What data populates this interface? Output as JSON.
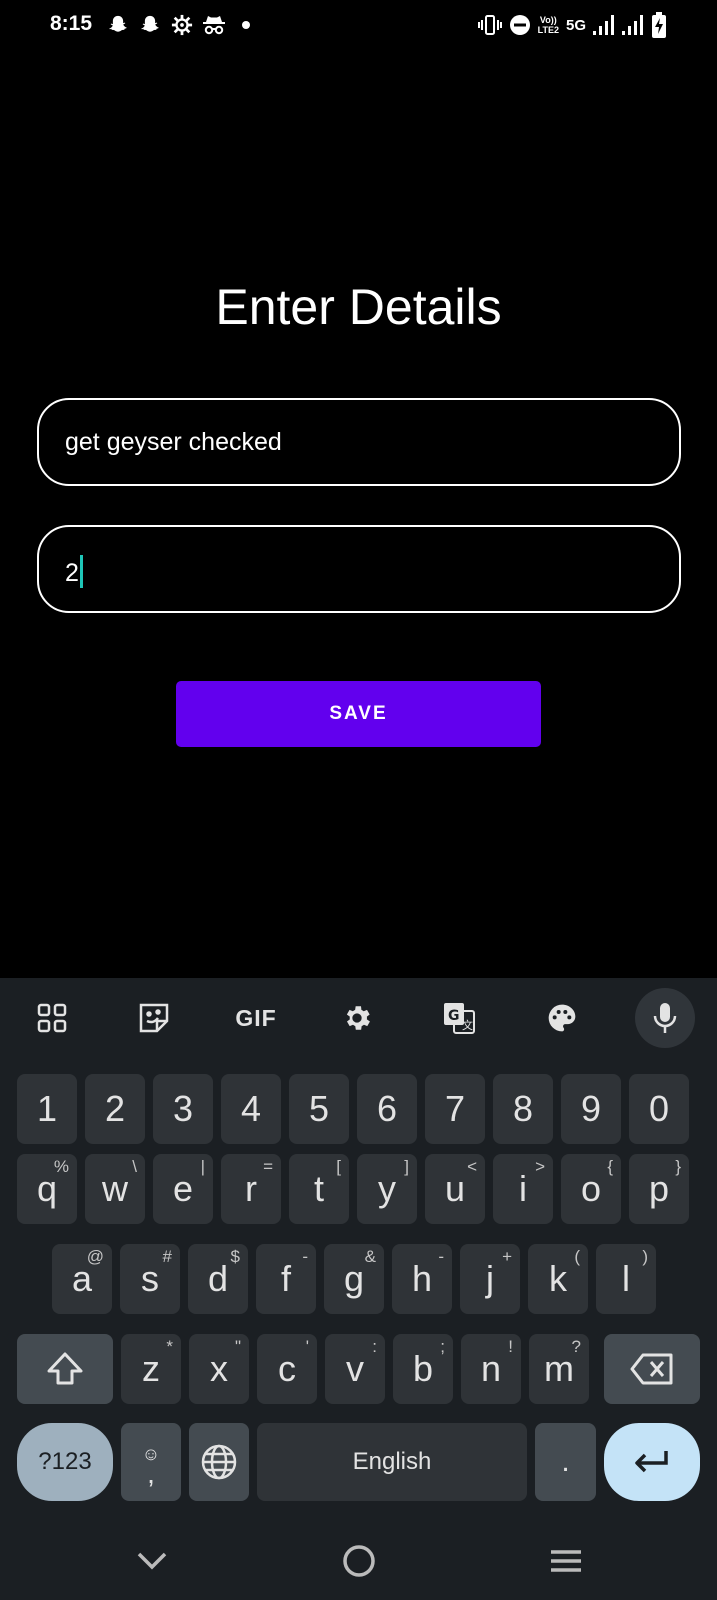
{
  "status_bar": {
    "time": "8:15",
    "network": "5G",
    "volte": "Vo))\nLTE2",
    "icons": [
      "snapchat-icon",
      "snapchat-icon",
      "settings-icon",
      "incognito-icon",
      "notification-dot",
      "vibrate-icon",
      "do-not-disturb-icon",
      "volte-icon",
      "signal-icon",
      "signal-icon",
      "battery-charging-icon"
    ]
  },
  "main": {
    "title": "Enter Details",
    "task_field": {
      "value": "get geyser checked"
    },
    "number_field": {
      "value": "2"
    },
    "save_button": {
      "label": "SAVE",
      "color": "#6200ee"
    }
  },
  "keyboard": {
    "toolbar": {
      "items": [
        "apps-grid-icon",
        "sticker-icon",
        "GIF",
        "settings-icon",
        "translate-icon",
        "palette-icon",
        "microphone-icon"
      ],
      "gif_label": "GIF"
    },
    "number_row": [
      "1",
      "2",
      "3",
      "4",
      "5",
      "6",
      "7",
      "8",
      "9",
      "0"
    ],
    "row1": [
      {
        "key": "q",
        "hint": "%"
      },
      {
        "key": "w",
        "hint": "\\"
      },
      {
        "key": "e",
        "hint": "|"
      },
      {
        "key": "r",
        "hint": "="
      },
      {
        "key": "t",
        "hint": "["
      },
      {
        "key": "y",
        "hint": "]"
      },
      {
        "key": "u",
        "hint": "<"
      },
      {
        "key": "i",
        "hint": ">"
      },
      {
        "key": "o",
        "hint": "{"
      },
      {
        "key": "p",
        "hint": "}"
      }
    ],
    "row2": [
      {
        "key": "a",
        "hint": "@"
      },
      {
        "key": "s",
        "hint": "#"
      },
      {
        "key": "d",
        "hint": "$"
      },
      {
        "key": "f",
        "hint": "-"
      },
      {
        "key": "g",
        "hint": "&"
      },
      {
        "key": "h",
        "hint": "-"
      },
      {
        "key": "j",
        "hint": "+"
      },
      {
        "key": "k",
        "hint": "("
      },
      {
        "key": "l",
        "hint": ")"
      }
    ],
    "row3": [
      {
        "key": "z",
        "hint": "*"
      },
      {
        "key": "x",
        "hint": "\""
      },
      {
        "key": "c",
        "hint": "'"
      },
      {
        "key": "v",
        "hint": ":"
      },
      {
        "key": "b",
        "hint": ";"
      },
      {
        "key": "n",
        "hint": "!"
      },
      {
        "key": "m",
        "hint": "?"
      }
    ],
    "symbols_label": "?123",
    "comma_label": ",",
    "space_label": "English",
    "period_label": "."
  },
  "nav_bar": {
    "buttons": [
      "back-chevron-icon",
      "home-icon",
      "recents-icon"
    ]
  }
}
